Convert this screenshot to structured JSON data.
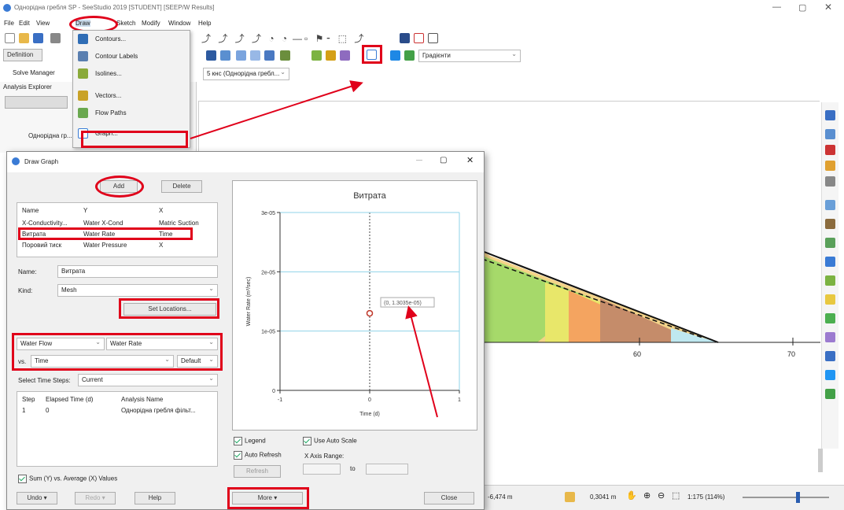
{
  "window": {
    "title": "Однорідна гребля SP - SeeStudio 2019 [STUDENT] [SEEP/W Results]"
  },
  "menubar": [
    "File",
    "Edit",
    "View",
    "Draw",
    "Sketch",
    "Modify",
    "Window",
    "Help"
  ],
  "draw_menu": [
    "Contours...",
    "Contour Labels",
    "Isolines...",
    "Vectors...",
    "Flow Paths",
    "Graph..."
  ],
  "toolbar": {
    "definition": "Definition",
    "solve_manager": "Solve Manager",
    "gradient_label": "Градієнти",
    "analysis_combo": "5 кнс (Однорідна гребл..."
  },
  "analysis_explorer": {
    "title": "Analysis Explorer",
    "item": "Однорідна гр..."
  },
  "dialog": {
    "title": "Draw Graph",
    "add_button": "Add",
    "delete_button": "Delete",
    "table_headers": [
      "Name",
      "Y",
      "X"
    ],
    "table_rows": [
      [
        "X-Conductivity...",
        "Water X-Cond",
        "Matric Suction"
      ],
      [
        "Витрата",
        "Water Rate",
        "Time"
      ],
      [
        "Поровий тиск",
        "Water Pressure",
        "X"
      ]
    ],
    "name_label": "Name:",
    "name_value": "Витрата",
    "kind_label": "Kind:",
    "kind_value": "Mesh",
    "set_locations": "Set Locations...",
    "y_category": "Water Flow",
    "y_variable": "Water Rate",
    "vs_label": "vs.",
    "x_variable": "Time",
    "x_default": "Default",
    "time_steps_label": "Select Time Steps:",
    "time_steps_value": "Current",
    "steps_headers": [
      "Step",
      "Elapsed Time (d)",
      "Analysis Name"
    ],
    "steps_rows": [
      [
        "1",
        "0",
        "Однорідна гребля фільт..."
      ]
    ],
    "sum_label": "Sum (Y) vs. Average (X) Values",
    "undo": "Undo",
    "redo": "Redo",
    "help": "Help",
    "more": "More",
    "close": "Close",
    "legend": "Legend",
    "auto_refresh": "Auto Refresh",
    "refresh": "Refresh",
    "use_auto_scale": "Use Auto Scale",
    "x_axis_range": "X Axis Range:",
    "to": "to"
  },
  "chart_data": {
    "type": "scatter",
    "title": "Витрата",
    "xlabel": "Time (d)",
    "ylabel": "Water Rate (m³/sec)",
    "xlim": [
      -1,
      1
    ],
    "ylim": [
      0,
      3e-05
    ],
    "x_ticks": [
      "-1",
      "0",
      "1"
    ],
    "y_ticks": [
      "0",
      "1e-05",
      "2e-05",
      "3e-05"
    ],
    "points": [
      {
        "x": 0,
        "y": 1.3e-05
      }
    ],
    "annotation": "(0, 1.3035e-05)",
    "point_color": "#c0392b",
    "grid": true
  },
  "model_view": {
    "axis_labels": [
      "60",
      "70"
    ]
  },
  "statusbar": {
    "coords": "-6,474 m",
    "scale": "0,3041 m",
    "zoom": "1:175 (114%)"
  }
}
